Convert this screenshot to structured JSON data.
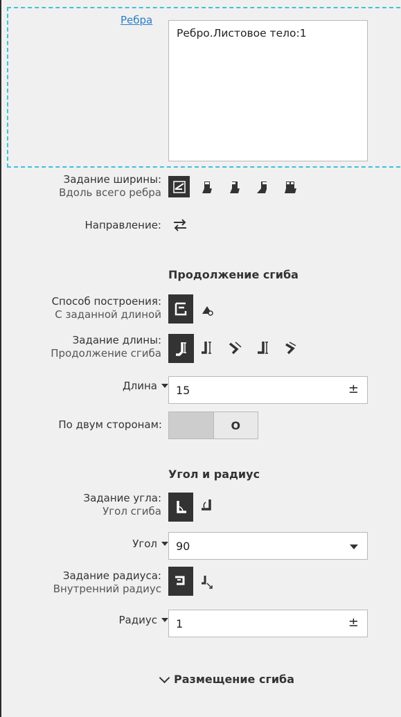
{
  "edges": {
    "link_label": "Ребра",
    "items": [
      "Ребро.Листовое тело:1"
    ]
  },
  "width_spec": {
    "label": "Задание ширины:",
    "value": "Вдоль всего ребра",
    "icons": [
      "width-along-edge-icon",
      "width-centered-icon",
      "width-left-icon",
      "width-right-icon",
      "width-two-sides-icon"
    ]
  },
  "direction": {
    "label": "Направление:",
    "icon": "direction-swap-icon"
  },
  "bend_continuation": {
    "title": "Продолжение сгиба",
    "build_method": {
      "label": "Способ построения:",
      "value": "С заданной длиной",
      "icons": [
        "given-length-icon",
        "to-vertex-icon"
      ]
    },
    "length_spec": {
      "label": "Задание длины:",
      "value": "Продолжение сгиба",
      "icons": [
        "length-continuation-icon",
        "length-outer-icon",
        "length-inner-icon",
        "length-flat-icon",
        "length-tangent-icon"
      ]
    },
    "length": {
      "label": "Длина",
      "value": "15",
      "pm": "±"
    },
    "both_sides": {
      "label": "По двум сторонам:",
      "toggle_label": "O"
    }
  },
  "angle_radius": {
    "title": "Угол и радиус",
    "angle_spec": {
      "label": "Задание угла:",
      "value": "Угол сгиба",
      "icons": [
        "bend-angle-icon",
        "complementary-angle-icon"
      ]
    },
    "angle": {
      "label": "Угол",
      "value": "90"
    },
    "radius_spec": {
      "label": "Задание радиуса:",
      "value": "Внутренний радиус",
      "icons": [
        "inner-radius-icon",
        "outer-radius-icon"
      ]
    },
    "radius": {
      "label": "Радиус",
      "value": "1",
      "pm": "±"
    }
  },
  "placement": {
    "label": "Размещение сгиба"
  }
}
